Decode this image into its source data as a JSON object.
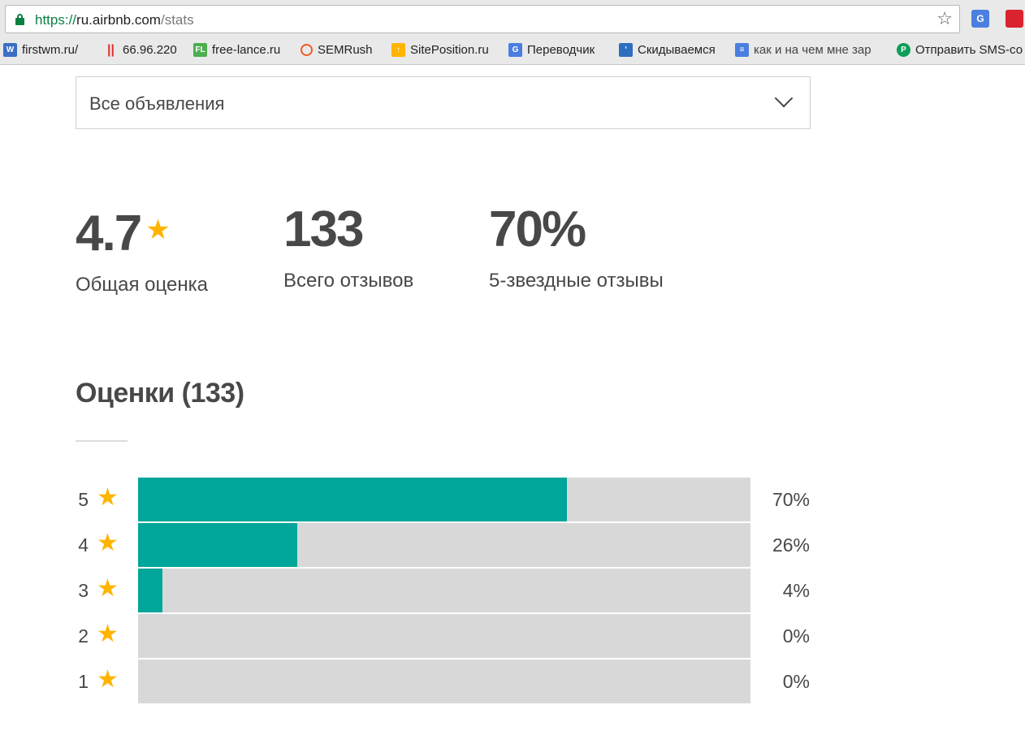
{
  "browser": {
    "url_scheme": "https://",
    "url_host": "ru.airbnb.com",
    "url_path": "/stats",
    "bookmarks": [
      {
        "label": "firstwm.ru/",
        "icon": "wm-icon",
        "color": "#3b6fc4"
      },
      {
        "label": "66.96.220",
        "icon": "bars-icon",
        "color": "#e0302a"
      },
      {
        "label": "free-lance.ru",
        "icon": "fl-icon",
        "color": "#4caf50"
      },
      {
        "label": "SEMRush",
        "icon": "semrush-icon",
        "color": "#f05a24"
      },
      {
        "label": "SitePosition.ru",
        "icon": "siteposition-icon",
        "color": "#ffb400"
      },
      {
        "label": "Переводчик",
        "icon": "translate-icon",
        "color": "#4a7fe0"
      },
      {
        "label": "Скидываемся",
        "icon": "skid-icon",
        "color": "#2d6fbf"
      },
      {
        "label": "как и на чем мне зар",
        "icon": "doc-icon",
        "color": "#4a7fe0"
      },
      {
        "label": "Отправить SMS-со",
        "icon": "sms-send-icon",
        "color": "#0f9d58"
      }
    ]
  },
  "listing_select": {
    "value": "Все объявления"
  },
  "stats": {
    "overall": {
      "value": "4.7",
      "label": "Общая оценка"
    },
    "total": {
      "value": "133",
      "label": "Всего отзывов"
    },
    "five_star": {
      "value": "70%",
      "label": "5-звездные отзывы"
    }
  },
  "ratings": {
    "heading": "Оценки (133)",
    "rows": [
      {
        "stars": "5",
        "percent_label": "70%",
        "fraction": 0.7
      },
      {
        "stars": "4",
        "percent_label": "26%",
        "fraction": 0.26
      },
      {
        "stars": "3",
        "percent_label": "4%",
        "fraction": 0.04
      },
      {
        "stars": "2",
        "percent_label": "0%",
        "fraction": 0
      },
      {
        "stars": "1",
        "percent_label": "0%",
        "fraction": 0
      }
    ]
  },
  "colors": {
    "accent": "#00a699",
    "star": "#ffb400",
    "track": "#d8d8d8"
  }
}
